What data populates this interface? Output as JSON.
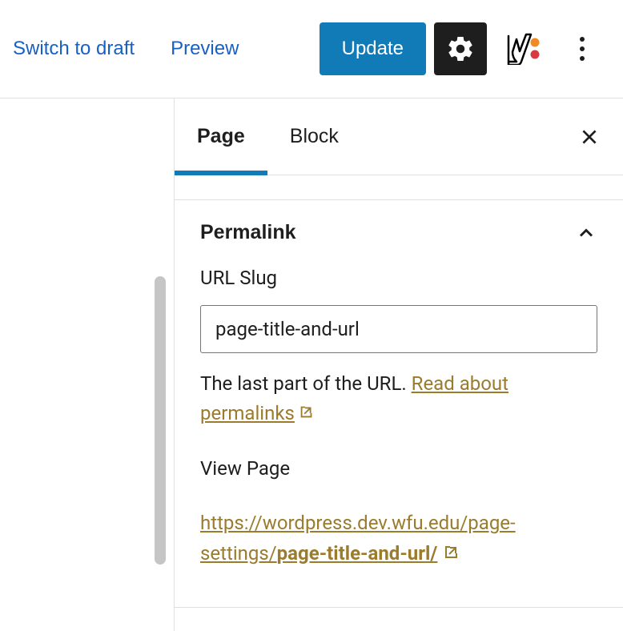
{
  "toolbar": {
    "switch_to_draft": "Switch to draft",
    "preview": "Preview",
    "update": "Update"
  },
  "sidebar": {
    "tabs": {
      "page": "Page",
      "block": "Block"
    },
    "permalink": {
      "title": "Permalink",
      "slug_label": "URL Slug",
      "slug_value": "page-title-and-url",
      "help_text": "The last part of the URL. ",
      "help_link": "Read about permalinks",
      "view_label": "View Page",
      "url_prefix": "https://wordpress.dev.wfu.edu/page-settings/",
      "url_slug": "page-title-and-url/"
    }
  }
}
